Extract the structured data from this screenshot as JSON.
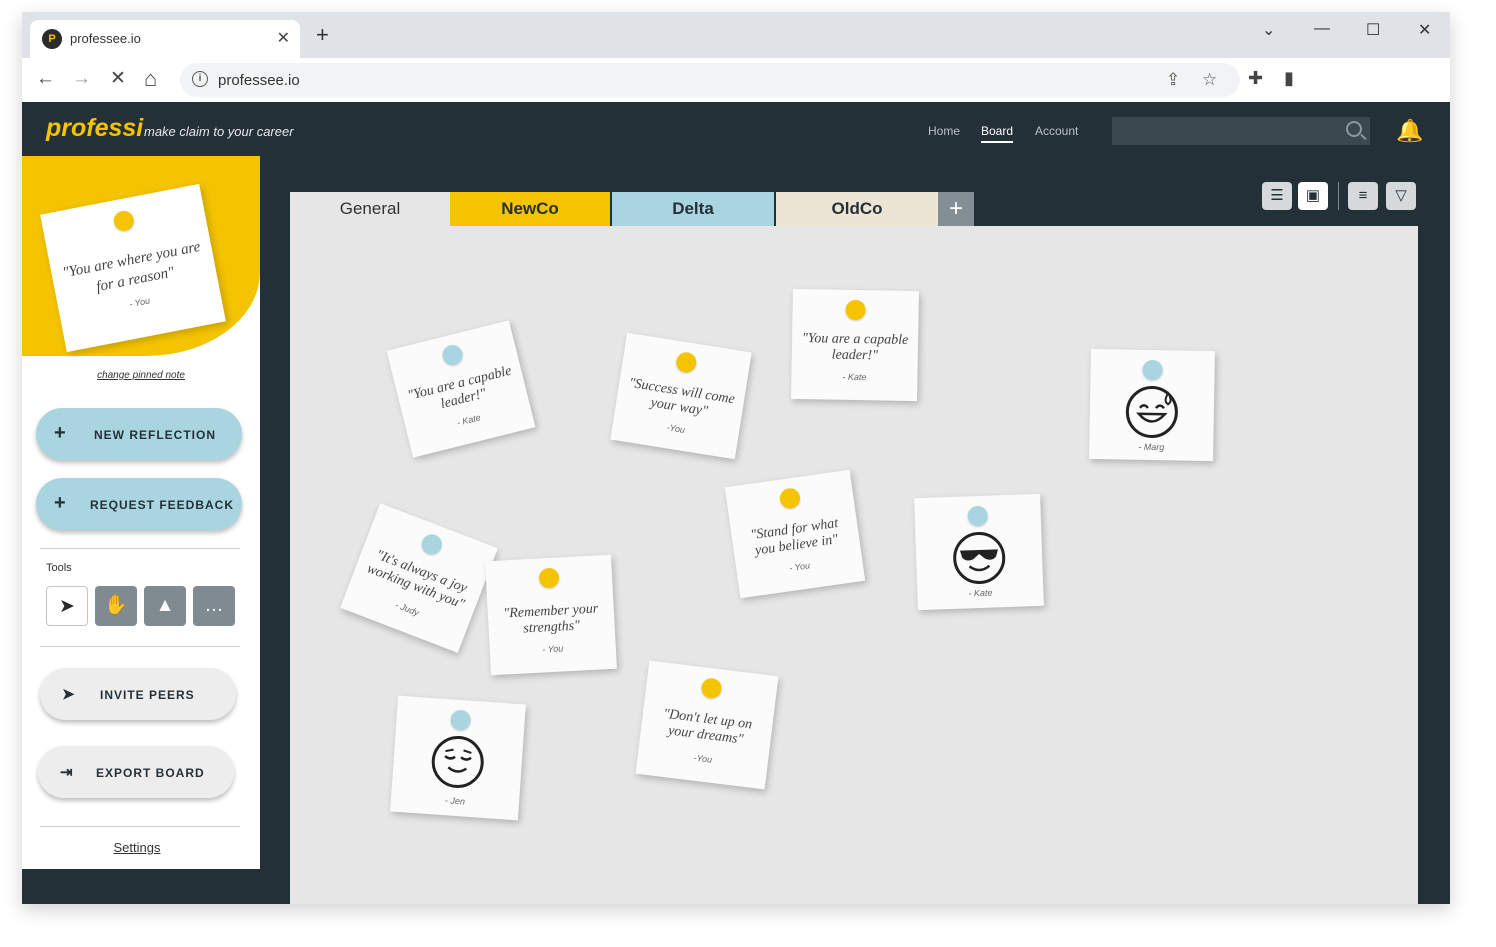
{
  "browser": {
    "tab_title": "professee.io",
    "favicon_letter": "P",
    "close_glyph": "✕",
    "new_tab_glyph": "+",
    "url": "professee.io",
    "controls": {
      "dropdown": "⌄",
      "minimize": "—",
      "maximize": "☐",
      "close": "✕"
    },
    "nav": {
      "back": "←",
      "forward": "→",
      "reload": "✕",
      "home": "⌂"
    },
    "icons": {
      "share": "⇪",
      "star": "☆",
      "extensions": "✚",
      "sidebar": "▮"
    }
  },
  "app": {
    "logo": "professi",
    "tagline": "make claim to your career",
    "nav": [
      {
        "label": "Home",
        "active": false
      },
      {
        "label": "Board",
        "active": true
      },
      {
        "label": "Account",
        "active": false
      }
    ],
    "search_placeholder": "",
    "bell_glyph": "🔔"
  },
  "sidebar": {
    "pinned_note": {
      "quote": "\"You are where you are for a reason\"",
      "author": "- You"
    },
    "change_pinned_label": "change pinned note",
    "new_reflection": {
      "icon": "+",
      "label": "NEW REFLECTION"
    },
    "request_feedback": {
      "icon": "+",
      "label": "REQUEST FEEDBACK"
    },
    "tools_label": "Tools",
    "tools": [
      {
        "name": "pointer",
        "glyph": "➤"
      },
      {
        "name": "hand",
        "glyph": "✋"
      },
      {
        "name": "stamp",
        "glyph": "▲"
      },
      {
        "name": "comment",
        "glyph": "…"
      }
    ],
    "invite_peers": {
      "icon": "➤",
      "label": "INVITE PEERS"
    },
    "export_board": {
      "icon": "⇥",
      "label": "EXPORT BOARD"
    },
    "settings_label": "Settings"
  },
  "board": {
    "tabs": [
      {
        "label": "General",
        "active": true
      },
      {
        "label": "NewCo",
        "color": "#f5c400"
      },
      {
        "label": "Delta",
        "color": "#a9d5e1"
      },
      {
        "label": "OldCo",
        "color": "#ece5d6"
      }
    ],
    "add_tab_glyph": "+",
    "view_buttons": {
      "list": "☰",
      "image": "▣",
      "sort": "≡",
      "filter": "▽"
    },
    "notes": [
      {
        "quote": "\"You are a capable leader!\"",
        "author": "- Kate",
        "pin": "blue"
      },
      {
        "quote": "\"Success will come your way\"",
        "author": "-You",
        "pin": "yellow"
      },
      {
        "quote": "\"You are a capable leader!\"",
        "author": "- Kate",
        "pin": "yellow"
      },
      {
        "emoji": "grin-sweat",
        "author": "- Marg",
        "pin": "blue"
      },
      {
        "quote": "\"It's always a joy working with you\"",
        "author": "- Judy",
        "pin": "blue"
      },
      {
        "quote": "\"Remember your strengths\"",
        "author": "- You",
        "pin": "yellow"
      },
      {
        "quote": "\"Stand for what you believe in\"",
        "author": "- You",
        "pin": "yellow"
      },
      {
        "emoji": "sunglasses",
        "author": "- Kate",
        "pin": "blue"
      },
      {
        "emoji": "relieved",
        "author": "- Jen",
        "pin": "blue"
      },
      {
        "quote": "\"Don't let up on your dreams\"",
        "author": "-You",
        "pin": "yellow"
      }
    ]
  },
  "colors": {
    "accent": "#f5c400",
    "teal": "#a9d5e1",
    "dark": "#243038",
    "board": "#e6e6e6"
  }
}
